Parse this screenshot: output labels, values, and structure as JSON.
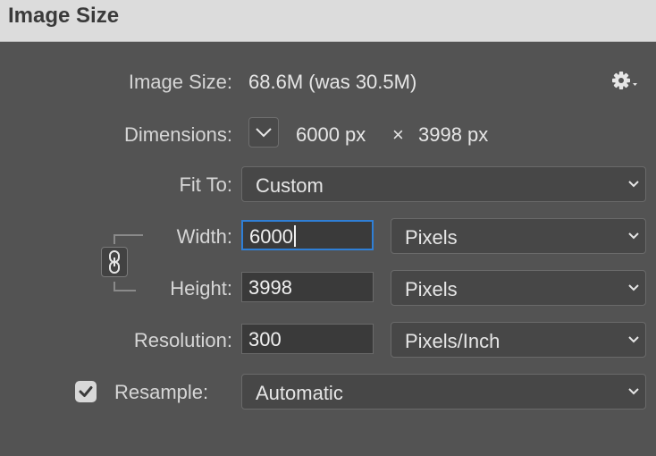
{
  "title": "Image Size",
  "image_size": {
    "label": "Image Size:",
    "value": "68.6M (was 30.5M)"
  },
  "settings_menu": {
    "icon": "gear-icon"
  },
  "dimensions": {
    "label": "Dimensions:",
    "width": "6000 px",
    "times": "×",
    "height": "3998 px"
  },
  "fit_to": {
    "label": "Fit To:",
    "value": "Custom"
  },
  "width": {
    "label": "Width:",
    "value": "6000",
    "unit": "Pixels"
  },
  "height": {
    "label": "Height:",
    "value": "3998",
    "unit": "Pixels"
  },
  "resolution": {
    "label": "Resolution:",
    "value": "300",
    "unit": "Pixels/Inch"
  },
  "resample": {
    "label": "Resample:",
    "checked": true,
    "value": "Automatic"
  },
  "constrain_proportions": {
    "linked": true,
    "icon": "chain-link-icon"
  },
  "colors": {
    "focus": "#2f7fd6",
    "background": "#535353",
    "titlebar": "#dcdcdc"
  }
}
